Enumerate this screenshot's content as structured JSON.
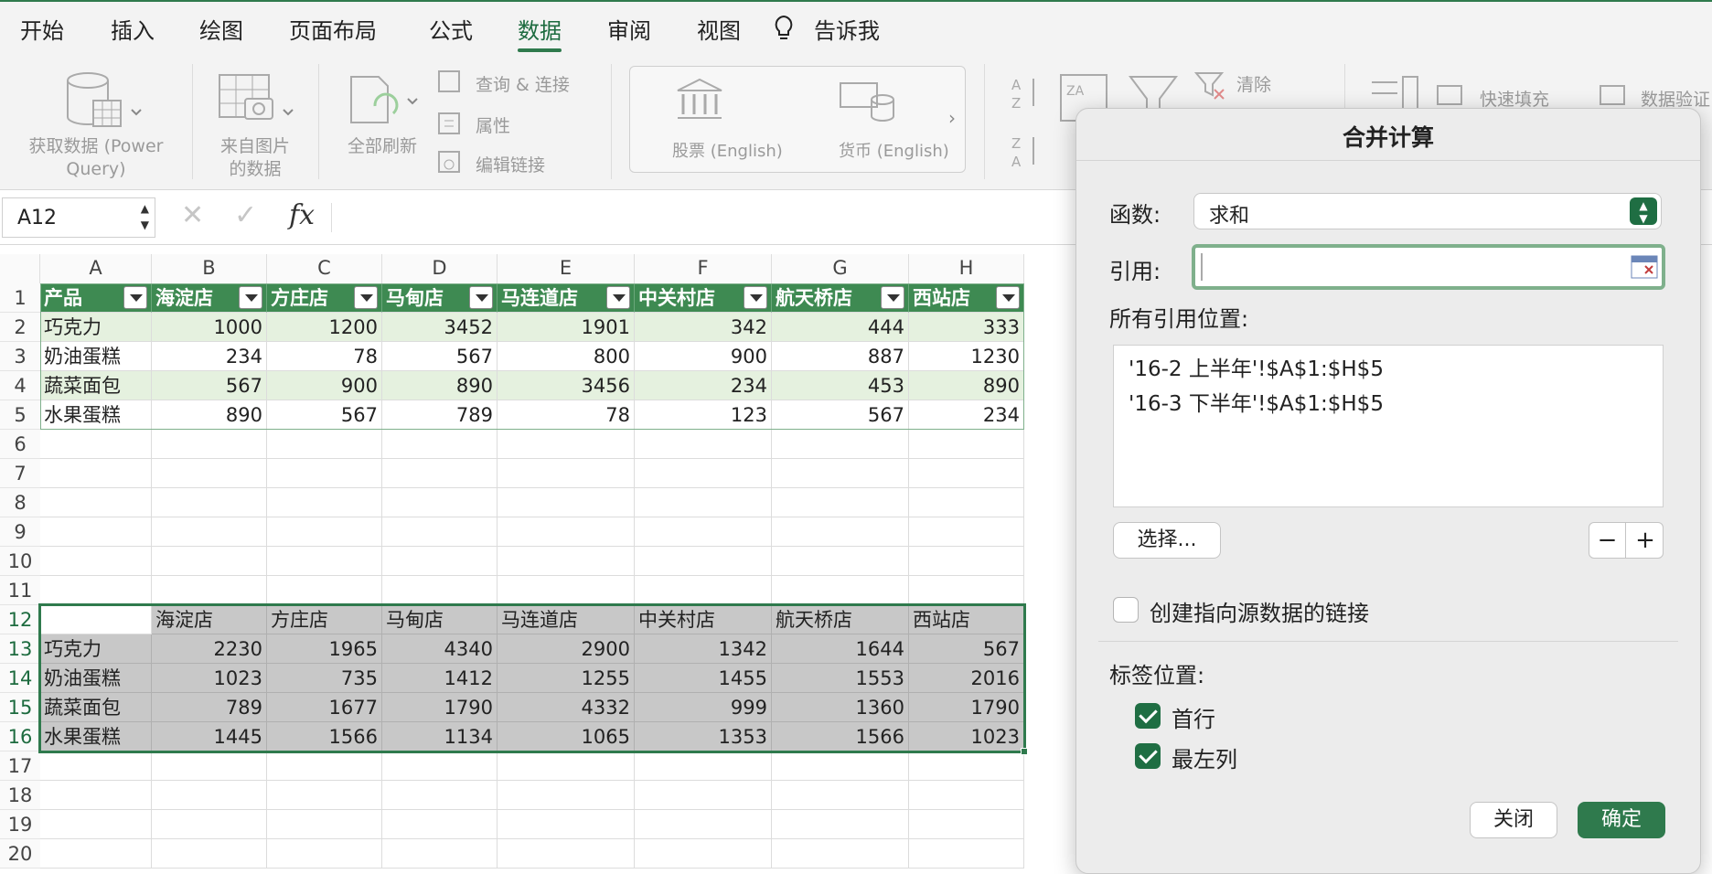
{
  "tabs": [
    {
      "label": "开始",
      "active": false
    },
    {
      "label": "插入",
      "active": false
    },
    {
      "label": "绘图",
      "active": false
    },
    {
      "label": "页面布局",
      "active": false
    },
    {
      "label": "公式",
      "active": false
    },
    {
      "label": "数据",
      "active": true
    },
    {
      "label": "审阅",
      "active": false
    },
    {
      "label": "视图",
      "active": false
    },
    {
      "label": "告诉我",
      "active": false
    }
  ],
  "ribbon": {
    "get_data": "获取数据 (Power\nQuery)",
    "from_picture": "来自图片\n的数据",
    "refresh_all": "全部刷新",
    "query_connect": "查询 & 连接",
    "properties": "属性",
    "edit_links": "编辑链接",
    "stocks": "股票 (English)",
    "currency": "货币 (English)",
    "clear": "清除",
    "flash_fill": "快速填充",
    "data_validation": "数据验证"
  },
  "formula_bar": {
    "name_box": "A12",
    "fx": "fx",
    "formula": ""
  },
  "columns": [
    "A",
    "B",
    "C",
    "D",
    "E",
    "F",
    "G",
    "H"
  ],
  "rows": [
    "1",
    "2",
    "3",
    "4",
    "5",
    "6",
    "7",
    "8",
    "9",
    "10",
    "11",
    "12",
    "13",
    "14",
    "15",
    "16",
    "17",
    "18",
    "19",
    "20"
  ],
  "table1": {
    "header": [
      "产品",
      "海淀店",
      "方庄店",
      "马甸店",
      "马连道店",
      "中关村店",
      "航天桥店",
      "西站店"
    ],
    "rows": [
      [
        "巧克力",
        "1000",
        "1200",
        "3452",
        "1901",
        "342",
        "444",
        "333"
      ],
      [
        "奶油蛋糕",
        "234",
        "78",
        "567",
        "800",
        "900",
        "887",
        "1230"
      ],
      [
        "蔬菜面包",
        "567",
        "900",
        "890",
        "3456",
        "234",
        "453",
        "890"
      ],
      [
        "水果蛋糕",
        "890",
        "567",
        "789",
        "78",
        "123",
        "567",
        "234"
      ]
    ]
  },
  "table2": {
    "header": [
      "",
      "海淀店",
      "方庄店",
      "马甸店",
      "马连道店",
      "中关村店",
      "航天桥店",
      "西站店"
    ],
    "rows": [
      [
        "巧克力",
        "2230",
        "1965",
        "4340",
        "2900",
        "1342",
        "1644",
        "567"
      ],
      [
        "奶油蛋糕",
        "1023",
        "735",
        "1412",
        "1255",
        "1455",
        "1553",
        "2016"
      ],
      [
        "蔬菜面包",
        "789",
        "1677",
        "1790",
        "4332",
        "999",
        "1360",
        "1790"
      ],
      [
        "水果蛋糕",
        "1445",
        "1566",
        "1134",
        "1065",
        "1353",
        "1566",
        "1023"
      ]
    ]
  },
  "dialog": {
    "title": "合并计算",
    "function_label": "函数:",
    "function_value": "求和",
    "reference_label": "引用:",
    "reference_value": "",
    "all_refs_label": "所有引用位置:",
    "all_refs": [
      "'16-2 上半年'!$A$1:$H$5",
      "'16-3 下半年'!$A$1:$H$5"
    ],
    "select_button": "选择...",
    "minus": "−",
    "plus": "+",
    "create_links_label": "创建指向源数据的链接",
    "create_links_checked": false,
    "label_position": "标签位置:",
    "top_row_label": "首行",
    "top_row_checked": true,
    "left_col_label": "最左列",
    "left_col_checked": true,
    "close_button": "关闭",
    "ok_button": "确定"
  },
  "colors": {
    "accent": "#2f7a4d",
    "header_fill": "#3e8a52",
    "band_fill": "#e5f1df",
    "selection_fill": "#c8c8c8"
  }
}
